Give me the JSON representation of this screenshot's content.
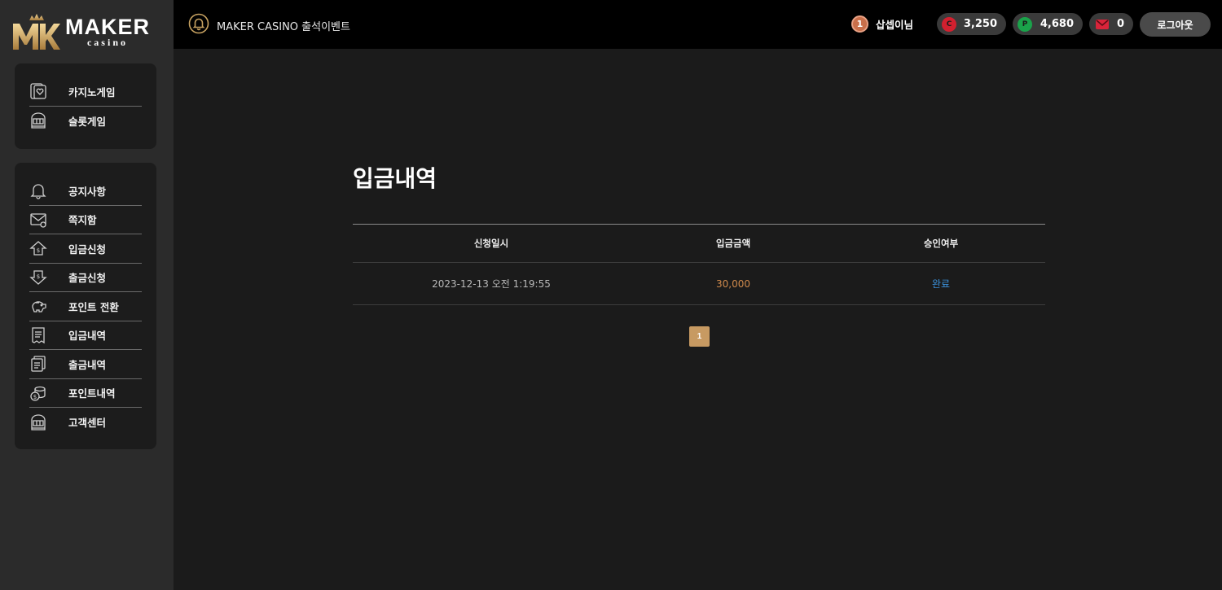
{
  "brand": {
    "name": "MAKER",
    "subname": "casino",
    "mark_letters": "MK",
    "gold": "#c7a261"
  },
  "sidebar": {
    "games": [
      {
        "label": "카지노게임",
        "icon": "card-heart-icon"
      },
      {
        "label": "슬롯게임",
        "icon": "slot-machine-icon"
      }
    ],
    "service": [
      {
        "label": "공지사항",
        "icon": "bell-icon"
      },
      {
        "label": "쪽지함",
        "icon": "envelope-icon"
      },
      {
        "label": "입금신청",
        "icon": "deposit-icon"
      },
      {
        "label": "출금신청",
        "icon": "withdraw-icon"
      },
      {
        "label": "포인트 전환",
        "icon": "piggy-bank-icon"
      },
      {
        "label": "입금내역",
        "icon": "receipt-icon"
      },
      {
        "label": "출금내역",
        "icon": "documents-icon"
      },
      {
        "label": "포인트내역",
        "icon": "coins-icon"
      },
      {
        "label": "고객센터",
        "icon": "headset-icon"
      }
    ]
  },
  "header": {
    "event_label": "MAKER CASINO 출석이벤트",
    "user": {
      "level": "1",
      "name": "삽셉이님"
    },
    "casino_money": {
      "coin": "C",
      "value": "3,250",
      "color": "#d2202f"
    },
    "point": {
      "coin": "P",
      "value": "4,680",
      "color": "#1aa24a"
    },
    "messages": {
      "value": "0",
      "color": "#d9243a"
    },
    "logout_label": "로그아웃"
  },
  "main": {
    "title": "입금내역",
    "columns": [
      "신청일시",
      "입금금액",
      "승인여부"
    ],
    "rows": [
      {
        "date": "2023-12-13 오전 1:19:55",
        "amount": "30,000",
        "status": "완료"
      }
    ],
    "pagination": {
      "current": "1"
    }
  }
}
